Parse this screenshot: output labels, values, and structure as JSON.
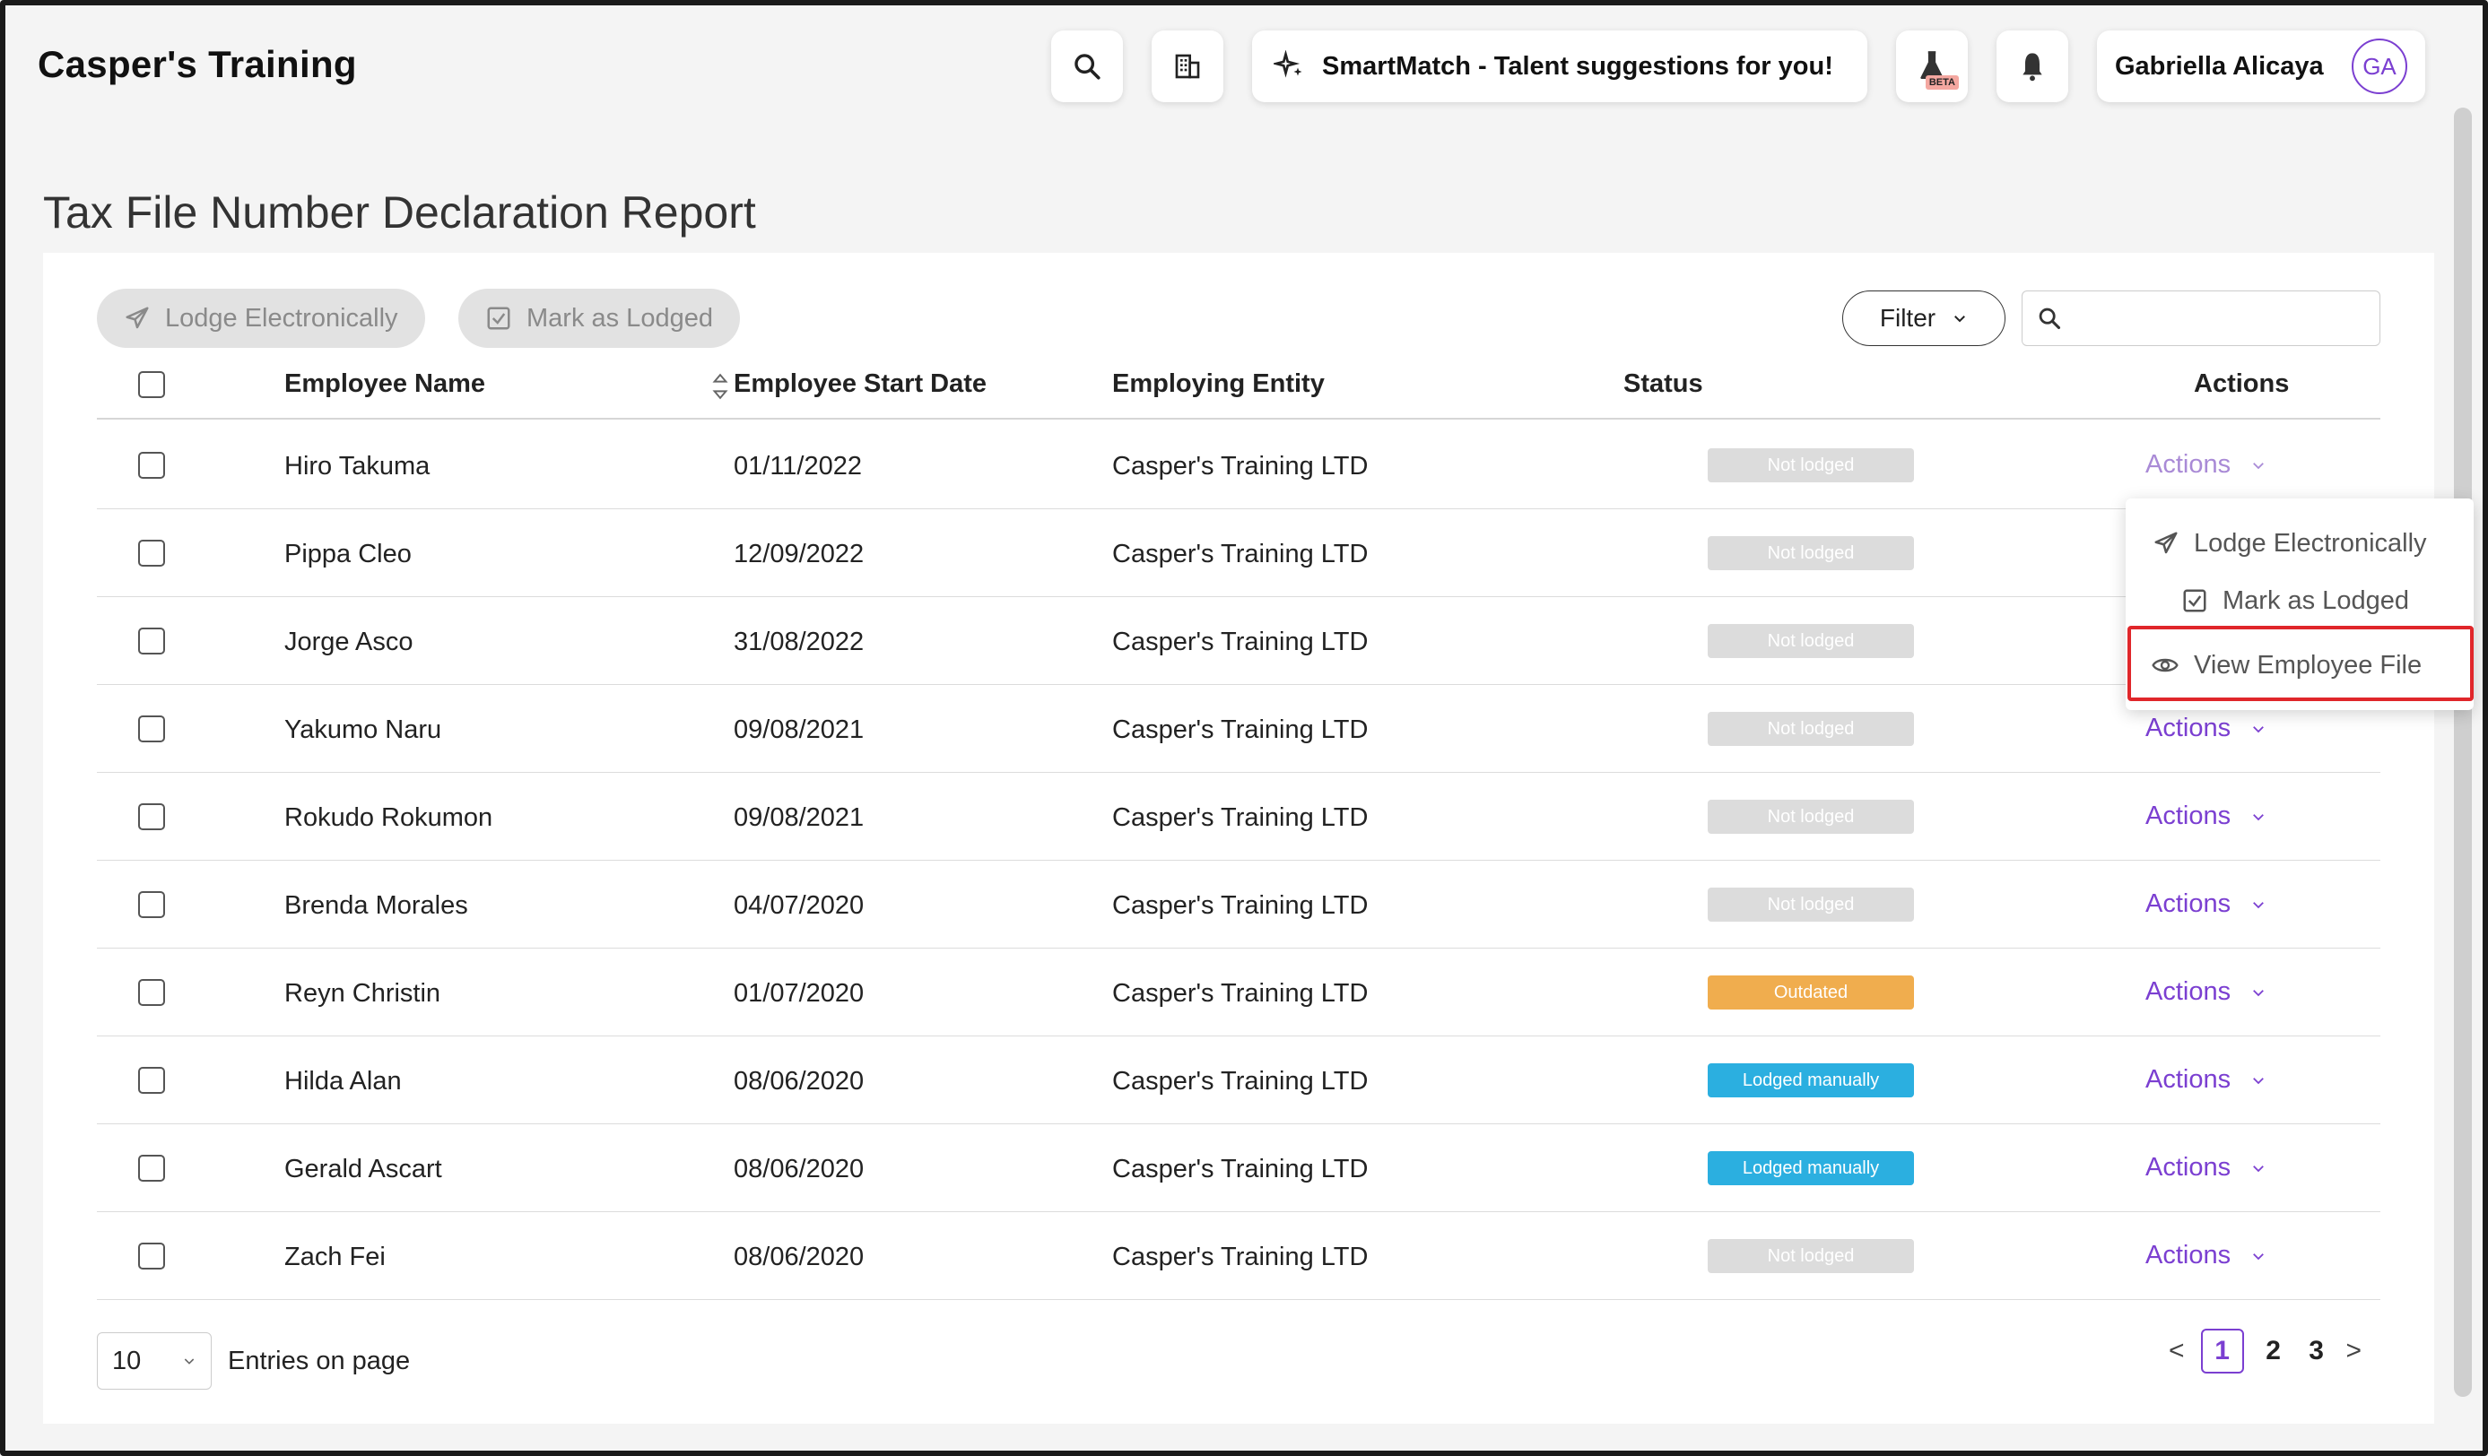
{
  "header": {
    "brand": "Casper's Training",
    "smartmatch_label": "SmartMatch - Talent suggestions for you!",
    "beta_label": "BETA",
    "user_name": "Gabriella Alicaya",
    "user_initials": "GA",
    "icons": [
      "search-icon",
      "building-icon",
      "sparkle-icon",
      "flask-icon",
      "bell-icon"
    ]
  },
  "page": {
    "title": "Tax File Number Declaration Report"
  },
  "toolbar": {
    "lodge_label": "Lodge Electronically",
    "mark_label": "Mark as Lodged",
    "filter_label": "Filter",
    "search_placeholder": ""
  },
  "table": {
    "columns": [
      "Employee Name",
      "Employee Start Date",
      "Employing Entity",
      "Status",
      "Actions"
    ],
    "rows": [
      {
        "name": "Hiro Takuma",
        "start": "01/11/2022",
        "entity": "Casper's Training LTD",
        "status": "Not lodged",
        "action": "Actions"
      },
      {
        "name": "Pippa Cleo",
        "start": "12/09/2022",
        "entity": "Casper's Training LTD",
        "status": "Not lodged",
        "action": "Actions"
      },
      {
        "name": "Jorge Asco",
        "start": "31/08/2022",
        "entity": "Casper's Training LTD",
        "status": "Not lodged",
        "action": "Actions"
      },
      {
        "name": "Yakumo Naru",
        "start": "09/08/2021",
        "entity": "Casper's Training LTD",
        "status": "Not lodged",
        "action": "Actions"
      },
      {
        "name": "Rokudo Rokumon",
        "start": "09/08/2021",
        "entity": "Casper's Training LTD",
        "status": "Not lodged",
        "action": "Actions"
      },
      {
        "name": "Brenda Morales",
        "start": "04/07/2020",
        "entity": "Casper's Training LTD",
        "status": "Not lodged",
        "action": "Actions"
      },
      {
        "name": "Reyn Christin",
        "start": "01/07/2020",
        "entity": "Casper's Training LTD",
        "status": "Outdated",
        "action": "Actions"
      },
      {
        "name": "Hilda Alan",
        "start": "08/06/2020",
        "entity": "Casper's Training LTD",
        "status": "Lodged manually",
        "action": "Actions"
      },
      {
        "name": "Gerald Ascart",
        "start": "08/06/2020",
        "entity": "Casper's Training LTD",
        "status": "Lodged manually",
        "action": "Actions"
      },
      {
        "name": "Zach Fei",
        "start": "08/06/2020",
        "entity": "Casper's Training LTD",
        "status": "Not lodged",
        "action": "Actions"
      }
    ]
  },
  "status_colors": {
    "Not lodged": "#dcdcdc",
    "Outdated": "#f0ad4e",
    "Lodged manually": "#2bafe0"
  },
  "dropdown": {
    "items": [
      "Lodge Electronically",
      "Mark as Lodged",
      "View Employee File"
    ]
  },
  "footer": {
    "page_size": "10",
    "entries_label": "Entries on page",
    "pages": [
      "1",
      "2",
      "3"
    ],
    "prev": "<",
    "next": ">"
  },
  "colors": {
    "accent": "#7b3fd1",
    "highlight": "#e0262a"
  }
}
